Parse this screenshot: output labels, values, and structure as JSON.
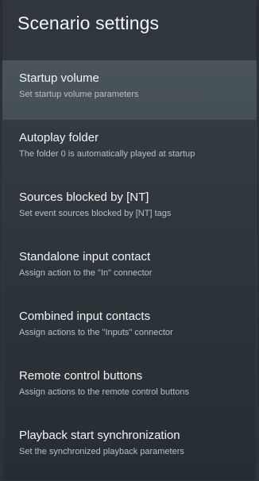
{
  "screen": {
    "title": "Scenario settings"
  },
  "colors": {
    "background": "#2c3338",
    "selected_row": "#4a545b",
    "label_text": "#f3f5f6",
    "description_text": "#b9c0c4"
  },
  "items": [
    {
      "label": "Startup volume",
      "description": "Set startup volume parameters",
      "selected": true
    },
    {
      "label": "Autoplay folder",
      "description": "The folder 0 is automatically played at startup",
      "selected": false
    },
    {
      "label": "Sources blocked by [NT]",
      "description": "Set event sources blocked by [NT] tags",
      "selected": false
    },
    {
      "label": "Standalone input contact",
      "description": "Assign action to the \"In\" connector",
      "selected": false
    },
    {
      "label": "Combined input contacts",
      "description": "Assign actions to the \"Inputs\" connector",
      "selected": false
    },
    {
      "label": "Remote control buttons",
      "description": "Assign actions to the remote control buttons",
      "selected": false
    },
    {
      "label": "Playback start synchronization",
      "description": "Set the synchronized playback parameters",
      "selected": false
    }
  ]
}
